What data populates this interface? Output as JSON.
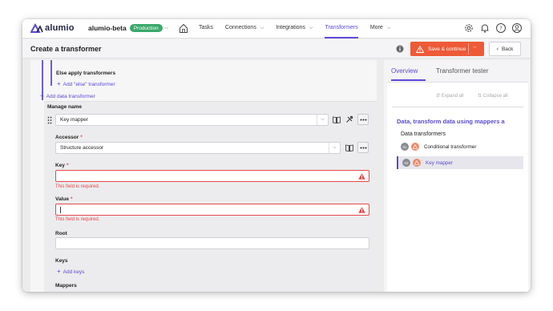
{
  "brand": {
    "logo_text": "alumio",
    "accent": "#5a49d6",
    "danger": "#ee5a37"
  },
  "account": {
    "name": "alumio-beta",
    "env_badge": "Production"
  },
  "nav": {
    "links": [
      {
        "label": "Tasks",
        "has_dropdown": false
      },
      {
        "label": "Connections",
        "has_dropdown": true
      },
      {
        "label": "Integrations",
        "has_dropdown": true
      },
      {
        "label": "Transformers",
        "has_dropdown": false,
        "active": true
      },
      {
        "label": "More",
        "has_dropdown": true
      }
    ],
    "icons": [
      "gear-icon",
      "bell-icon",
      "help-icon",
      "user-icon"
    ]
  },
  "header": {
    "title": "Create a transformer",
    "save_label": "Save & continue",
    "back_label": "Back"
  },
  "form": {
    "else_title": "Else apply transformers",
    "add_else_label": "Add \"else\" transformer",
    "add_data_transformer_label": "Add data transformer",
    "manage_name_label": "Manage name",
    "transformer_select_value": "Key mapper",
    "accessor": {
      "label": "Accessor",
      "required": "*",
      "value": "Structure accessor"
    },
    "key": {
      "label": "Key",
      "required": "*",
      "value": "",
      "error": "This field is required."
    },
    "value": {
      "label": "Value",
      "required": "*",
      "value": "",
      "error": "This field is required."
    },
    "root": {
      "label": "Root",
      "value": ""
    },
    "keys": {
      "label": "Keys",
      "add_label": "Add keys"
    },
    "mappers": {
      "label": "Mappers"
    }
  },
  "tester": {
    "tabs": [
      {
        "label": "Overview",
        "active": true
      },
      {
        "label": "Transformer tester",
        "active": false
      }
    ],
    "expand_all": "Expand all",
    "collapse_all": "Collapse all",
    "title": "Data, transform data using mappers a",
    "section": "Data transformers",
    "items": [
      {
        "num": "01",
        "label": "Conditional transformer",
        "selected": false
      },
      {
        "num": "02",
        "label": "Key mapper",
        "selected": true
      }
    ]
  }
}
